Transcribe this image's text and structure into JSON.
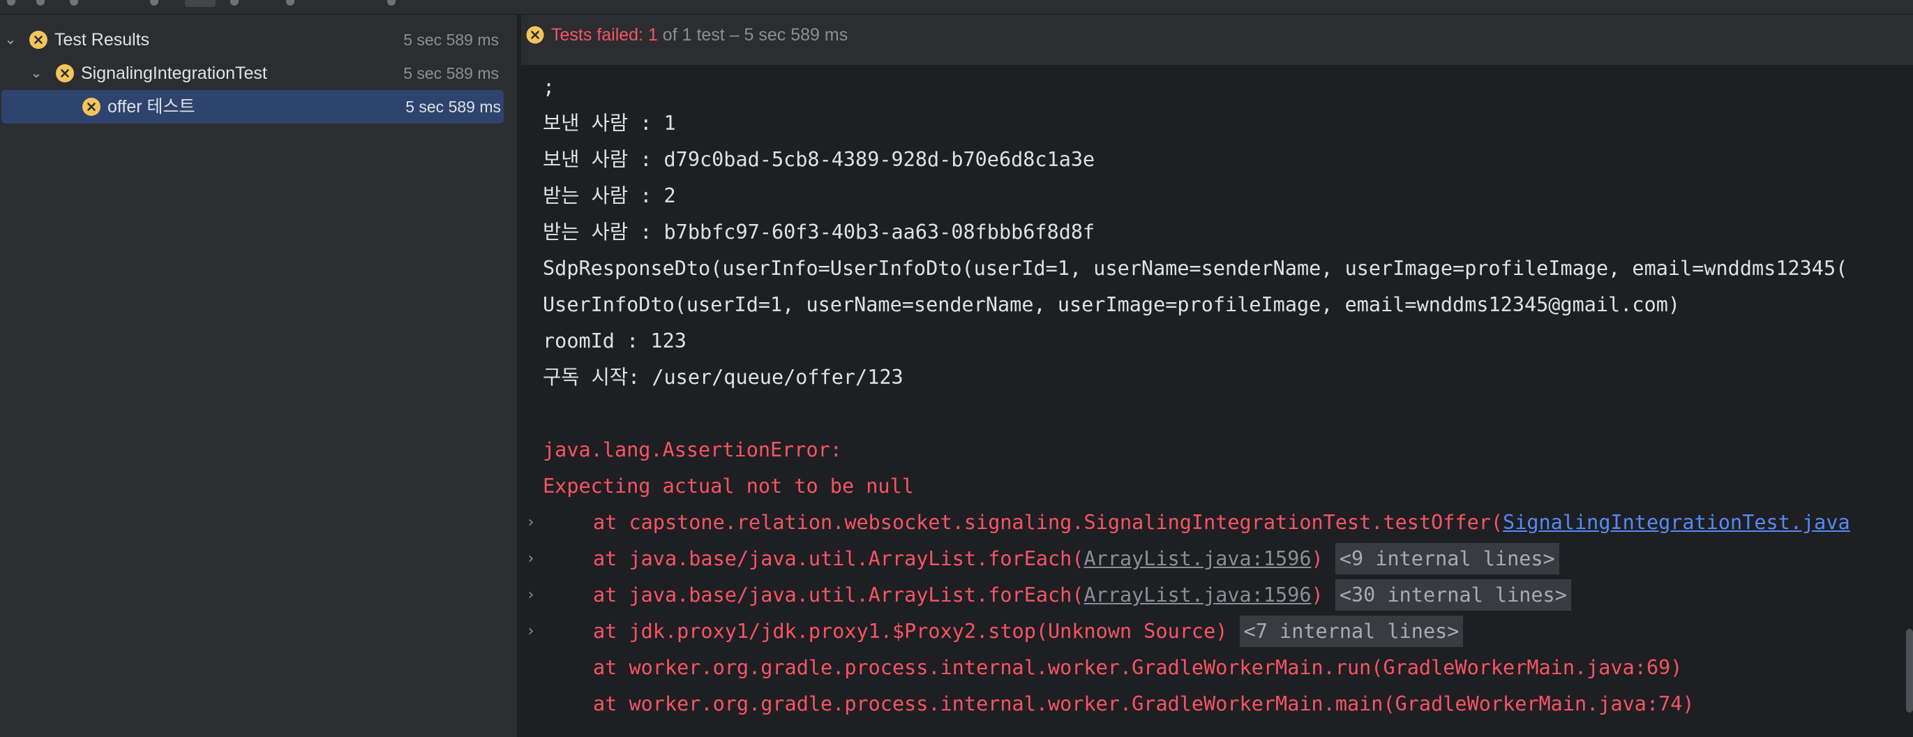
{
  "tree": {
    "items": [
      {
        "label": "Test Results",
        "time": "5 sec 589 ms"
      },
      {
        "label": "SignalingIntegrationTest",
        "time": "5 sec 589 ms"
      },
      {
        "label": "offer 테스트",
        "time": "5 sec 589 ms"
      }
    ]
  },
  "status": {
    "failed_label": "Tests failed: 1",
    "summary": " of 1 test – 5 sec 589 ms"
  },
  "console": {
    "lines": [
      ";",
      "보낸 사람 : 1",
      "보낸 사람 : d79c0bad-5cb8-4389-928d-b70e6d8c1a3e",
      "받는 사람 : 2",
      "받는 사람 : b7bbfc97-60f3-40b3-aa63-08fbbb6f8d8f",
      "SdpResponseDto(userInfo=UserInfoDto(userId=1, userName=senderName, userImage=profileImage, email=wnddms12345(",
      "UserInfoDto(userId=1, userName=senderName, userImage=profileImage, email=wnddms12345@gmail.com)",
      "roomId : 123",
      "구독 시작: /user/queue/offer/123"
    ],
    "error_lines": [
      "java.lang.AssertionError:",
      "Expecting actual not to be null"
    ],
    "stack": [
      {
        "prefix": "at capstone.relation.websocket.signaling.SignalingIntegrationTest.testOffer(",
        "link": "SignalingIntegrationTest.java",
        "suffix": "",
        "internal": ""
      },
      {
        "prefix": "at java.base/java.util.ArrayList.forEach(",
        "link": "ArrayList.java:1596",
        "suffix": ")",
        "internal": "<9 internal lines>"
      },
      {
        "prefix": "at java.base/java.util.ArrayList.forEach(",
        "link": "ArrayList.java:1596",
        "suffix": ")",
        "internal": "<30 internal lines>"
      },
      {
        "prefix": "at jdk.proxy1/jdk.proxy1.$Proxy2.stop(Unknown Source)",
        "link": "",
        "suffix": "",
        "internal": "<7 internal lines>"
      },
      {
        "prefix": "at worker.org.gradle.process.internal.worker.GradleWorkerMain.run(GradleWorkerMain.java:69)",
        "link": "",
        "suffix": "",
        "internal": ""
      },
      {
        "prefix": "at worker.org.gradle.process.internal.worker.GradleWorkerMain.main(GradleWorkerMain.java:74)",
        "link": "",
        "suffix": "",
        "internal": ""
      }
    ]
  },
  "colors": {
    "accent_fail": "#f75464",
    "selection": "#2e436e",
    "fail_icon": "#f2c55c"
  }
}
